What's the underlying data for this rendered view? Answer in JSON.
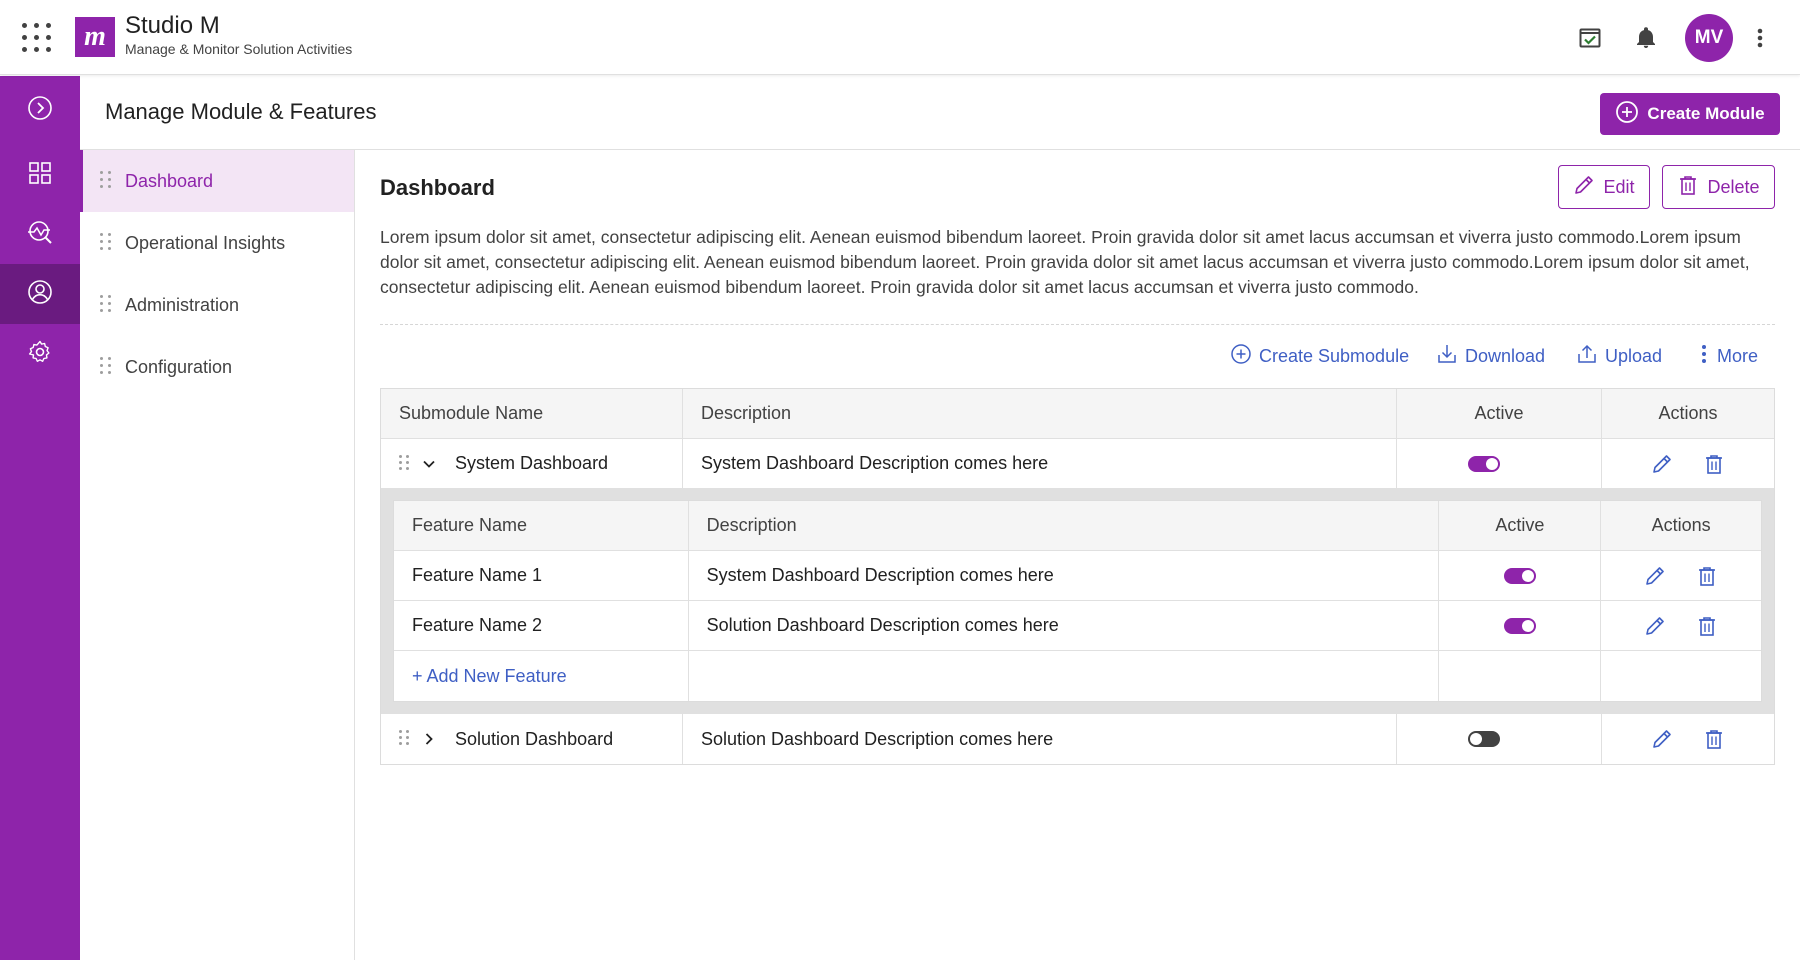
{
  "app": {
    "title": "Studio M",
    "subtitle": "Manage & Monitor Solution Activities",
    "logo_letter": "m",
    "avatar_initials": "MV",
    "accent_color": "#8e24aa"
  },
  "topbar_icons": [
    "apps-grid-icon",
    "task-check-icon",
    "bell-icon",
    "more-vertical-icon"
  ],
  "rail": {
    "items": [
      {
        "icon": "chevron-right-circle-icon"
      },
      {
        "icon": "dashboard-grid-icon"
      },
      {
        "icon": "insights-icon"
      },
      {
        "icon": "user-circle-icon",
        "active": true
      },
      {
        "icon": "settings-gear-icon"
      }
    ]
  },
  "page": {
    "title": "Manage Module & Features",
    "create_module_label": "Create Module"
  },
  "subnav": {
    "items": [
      {
        "label": "Dashboard",
        "active": true
      },
      {
        "label": "Operational Insights"
      },
      {
        "label": "Administration"
      },
      {
        "label": "Configuration"
      }
    ]
  },
  "content": {
    "title": "Dashboard",
    "edit_label": "Edit",
    "delete_label": "Delete",
    "description": "Lorem ipsum dolor sit amet, consectetur adipiscing elit. Aenean euismod bibendum laoreet. Proin gravida dolor sit amet lacus accumsan et viverra justo commodo.Lorem ipsum dolor sit amet, consectetur adipiscing elit. Aenean euismod bibendum laoreet. Proin gravida dolor sit amet lacus accumsan et viverra justo commodo.Lorem ipsum dolor sit amet, consectetur adipiscing elit. Aenean euismod bibendum laoreet. Proin gravida dolor sit amet lacus accumsan et viverra justo commodo."
  },
  "actions": {
    "create_submodule": "Create Submodule",
    "download": "Download",
    "upload": "Upload",
    "more": "More"
  },
  "submodule_table": {
    "headers": [
      "Submodule Name",
      "Description",
      "Active",
      "Actions"
    ],
    "rows": [
      {
        "name": "System Dashboard",
        "description": "System Dashboard Description comes here",
        "active": true,
        "expanded": true
      },
      {
        "name": "Solution Dashboard",
        "description": "Solution Dashboard Description comes here",
        "active": false,
        "expanded": false
      }
    ]
  },
  "feature_table": {
    "headers": [
      "Feature Name",
      "Description",
      "Active",
      "Actions"
    ],
    "rows": [
      {
        "name": "Feature Name 1",
        "description": "System Dashboard Description comes here",
        "active": true
      },
      {
        "name": "Feature Name 2",
        "description": "Solution Dashboard Description comes here",
        "active": true
      }
    ],
    "add_label": "+ Add New Feature"
  }
}
